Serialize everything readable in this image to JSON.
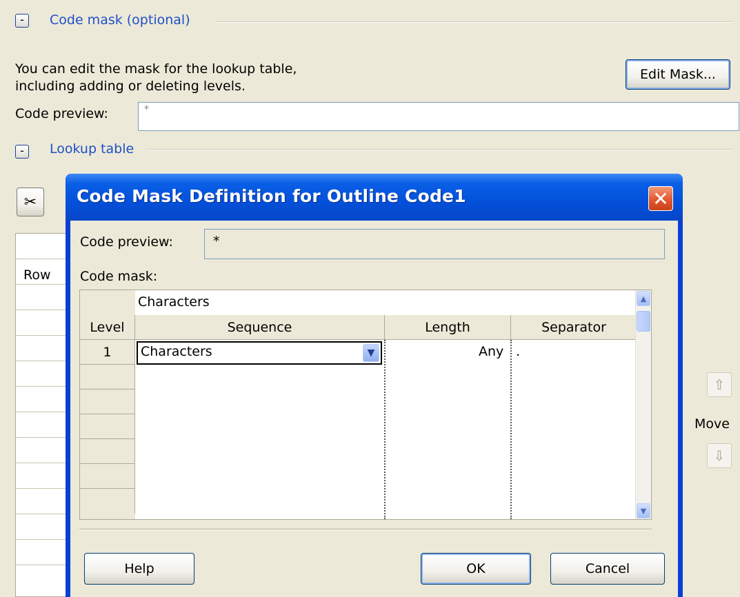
{
  "parent": {
    "code_mask_section_title": "Code mask (optional)",
    "collapse_glyph": "-",
    "description_line1": "You can edit the mask for the lookup table,",
    "description_line2": "including adding or deleting levels.",
    "edit_mask_button": "Edit Mask...",
    "code_preview_label": "Code preview:",
    "code_preview_value": "*",
    "lookup_table_section_title": "Lookup table",
    "cut_icon": "scissors-icon",
    "row_header": "Row",
    "move_label": "Move",
    "move_up_icon": "arrow-up-icon",
    "move_down_icon": "arrow-down-icon"
  },
  "dialog": {
    "title": "Code Mask Definition for Outline Code1",
    "close_icon": "close-icon",
    "code_preview_label": "Code preview:",
    "code_preview_value": "*",
    "code_mask_label": "Code mask:",
    "grid": {
      "top_row_text": "Characters",
      "columns": [
        "Level",
        "Sequence",
        "Length",
        "Separator"
      ],
      "rows": [
        {
          "level": "1",
          "sequence": "Characters",
          "length": "Any",
          "separator": "."
        }
      ]
    },
    "buttons": {
      "help": "Help",
      "ok": "OK",
      "cancel": "Cancel"
    }
  },
  "colors": {
    "titlebar": "#0450da",
    "window_bg": "#ece9d8",
    "link_blue": "#1e50c8",
    "close_red": "#e2582f"
  }
}
